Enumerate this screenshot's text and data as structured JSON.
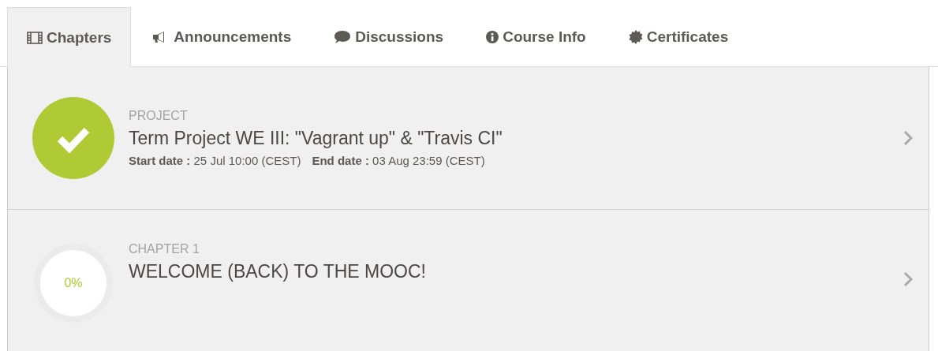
{
  "tabs": [
    {
      "label": "Chapters",
      "kind": "film",
      "selected": true
    },
    {
      "label": "Announcements",
      "kind": "megaphone",
      "selected": false
    },
    {
      "label": "Discussions",
      "kind": "comment",
      "selected": false
    },
    {
      "label": "Course Info",
      "kind": "info",
      "selected": false
    },
    {
      "label": "Certificates",
      "kind": "certificate",
      "selected": false
    }
  ],
  "items": [
    {
      "kind": "completed",
      "category": "PROJECT",
      "title": "Term Project WE III: \"Vagrant up\" & \"Travis CI\"",
      "dates": [
        "**Start date :** 25 Jul 10:00 (CEST)",
        "**End date :** 03 Aug 23:59 (CEST)"
      ]
    },
    {
      "kind": "progress",
      "category": "CHAPTER 1",
      "title": "WELCOME (BACK) TO THE MOOC!",
      "level": 0,
      "progress": "0%"
    }
  ]
}
